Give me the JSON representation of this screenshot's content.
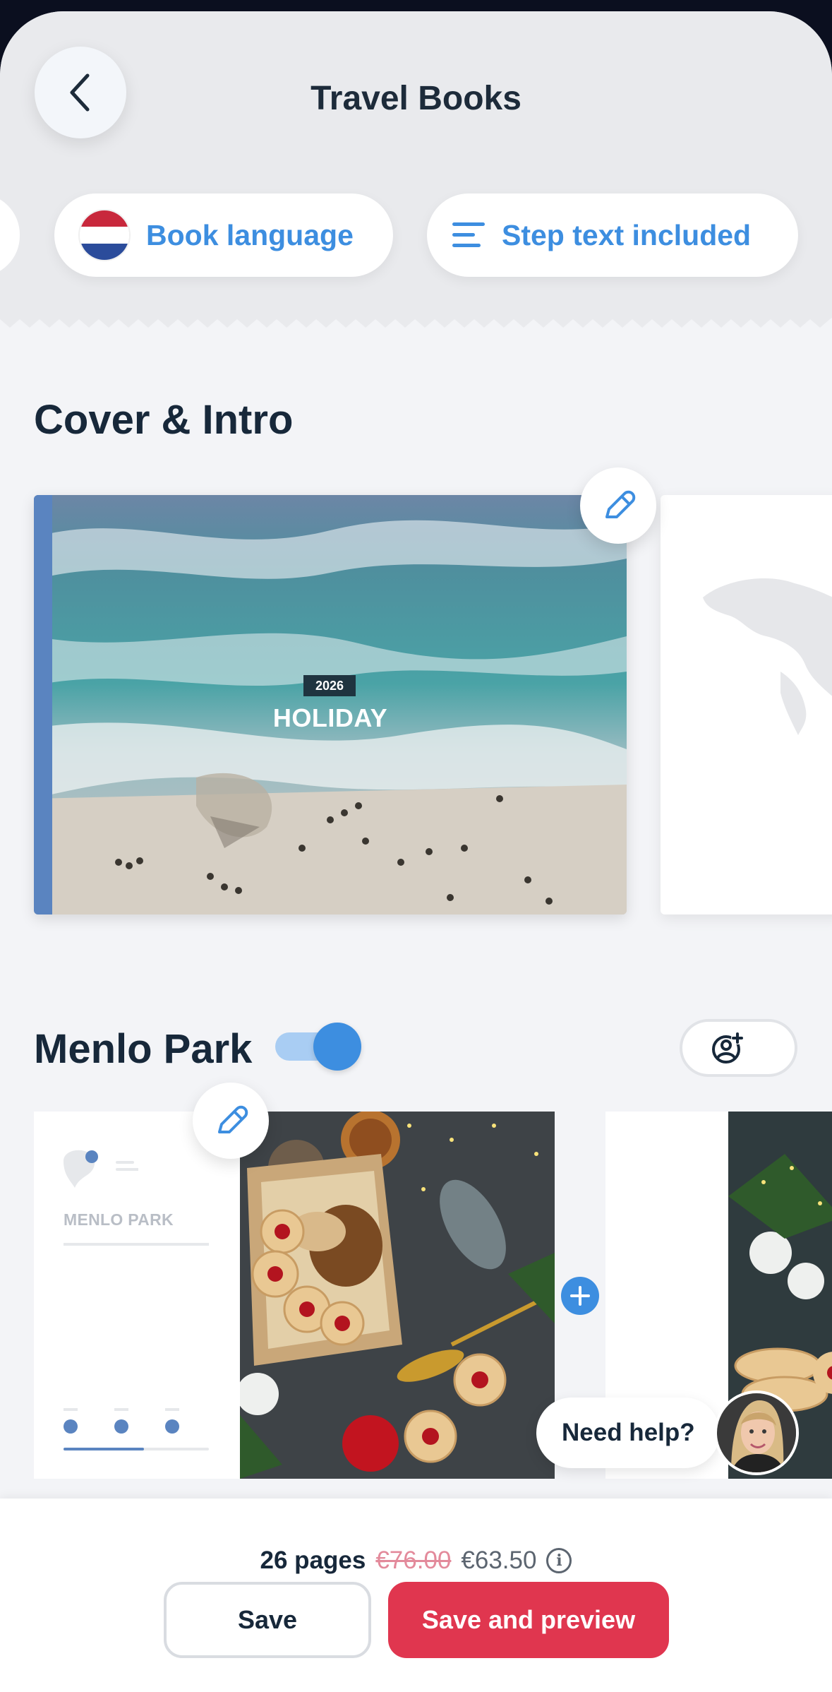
{
  "header": {
    "title": "Travel Books",
    "back_icon": "chevron-left-icon"
  },
  "filters": {
    "language_label": "Book language",
    "language_flag": "netherlands-flag",
    "text_label": "Step text included",
    "text_icon": "align-left-icon"
  },
  "cover_section": {
    "title": "Cover & Intro",
    "year": "2026",
    "cover_title": "HOLIDAY",
    "edit_icon": "pencil-icon"
  },
  "step_section": {
    "title": "Menlo Park",
    "toggle_on": true,
    "page_label": "MENLO PARK",
    "add_photo_icon": "add-photo-icon",
    "plus_icon": "plus-icon"
  },
  "help": {
    "label": "Need help?"
  },
  "footer": {
    "pages": "26 pages",
    "old_price": "€76.00",
    "new_price": "€63.50",
    "save_label": "Save",
    "preview_label": "Save and preview"
  },
  "colors": {
    "accent": "#3d8ee0",
    "primary_button": "#e0364f",
    "text_dark": "#17283a"
  }
}
